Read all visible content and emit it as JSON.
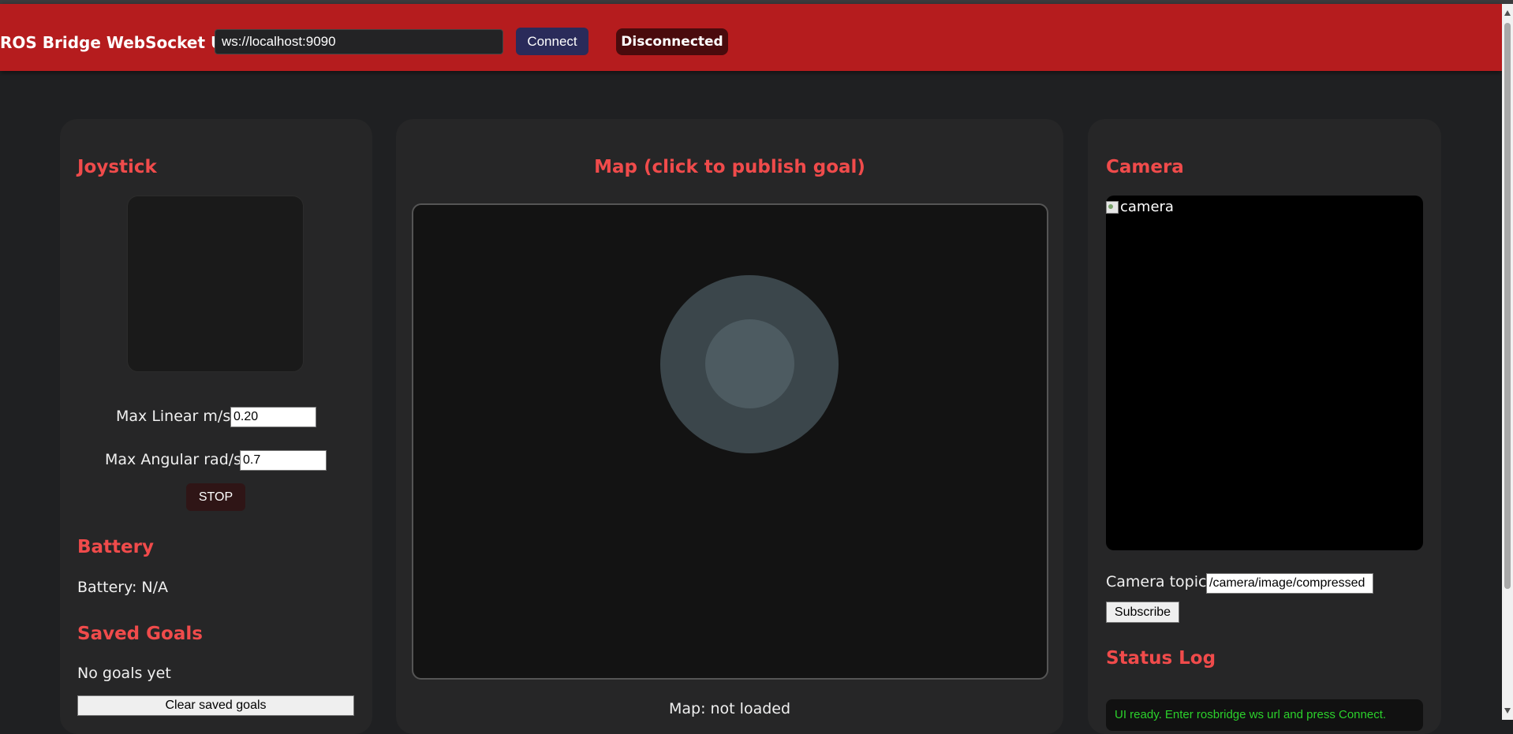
{
  "header": {
    "url_label": "ROS Bridge WebSocket URL:",
    "url_value": "ws://localhost:9090",
    "connect_label": "Connect",
    "status": "Disconnected"
  },
  "colors": {
    "header_bg": "#b51c1e",
    "accent": "#f04b4b",
    "log_text": "#2bd12b"
  },
  "joystick": {
    "title": "Joystick",
    "max_linear_label": "Max Linear m/s:",
    "max_linear_value": "0.20",
    "max_angular_label": "Max Angular rad/s:",
    "max_angular_value": "0.7",
    "stop_label": "STOP"
  },
  "battery": {
    "title": "Battery",
    "text": "Battery: N/A"
  },
  "saved_goals": {
    "title": "Saved Goals",
    "empty_text": "No goals yet",
    "clear_label": "Clear saved goals"
  },
  "map": {
    "title": "Map (click to publish goal)",
    "status": "Map: not loaded"
  },
  "camera": {
    "title": "Camera",
    "image_alt": "camera",
    "topic_label": "Camera topic:",
    "topic_value": "/camera/image/compressed",
    "subscribe_label": "Subscribe"
  },
  "status_log": {
    "title": "Status Log",
    "lines": [
      "UI ready. Enter rosbridge ws url and press Connect."
    ]
  }
}
